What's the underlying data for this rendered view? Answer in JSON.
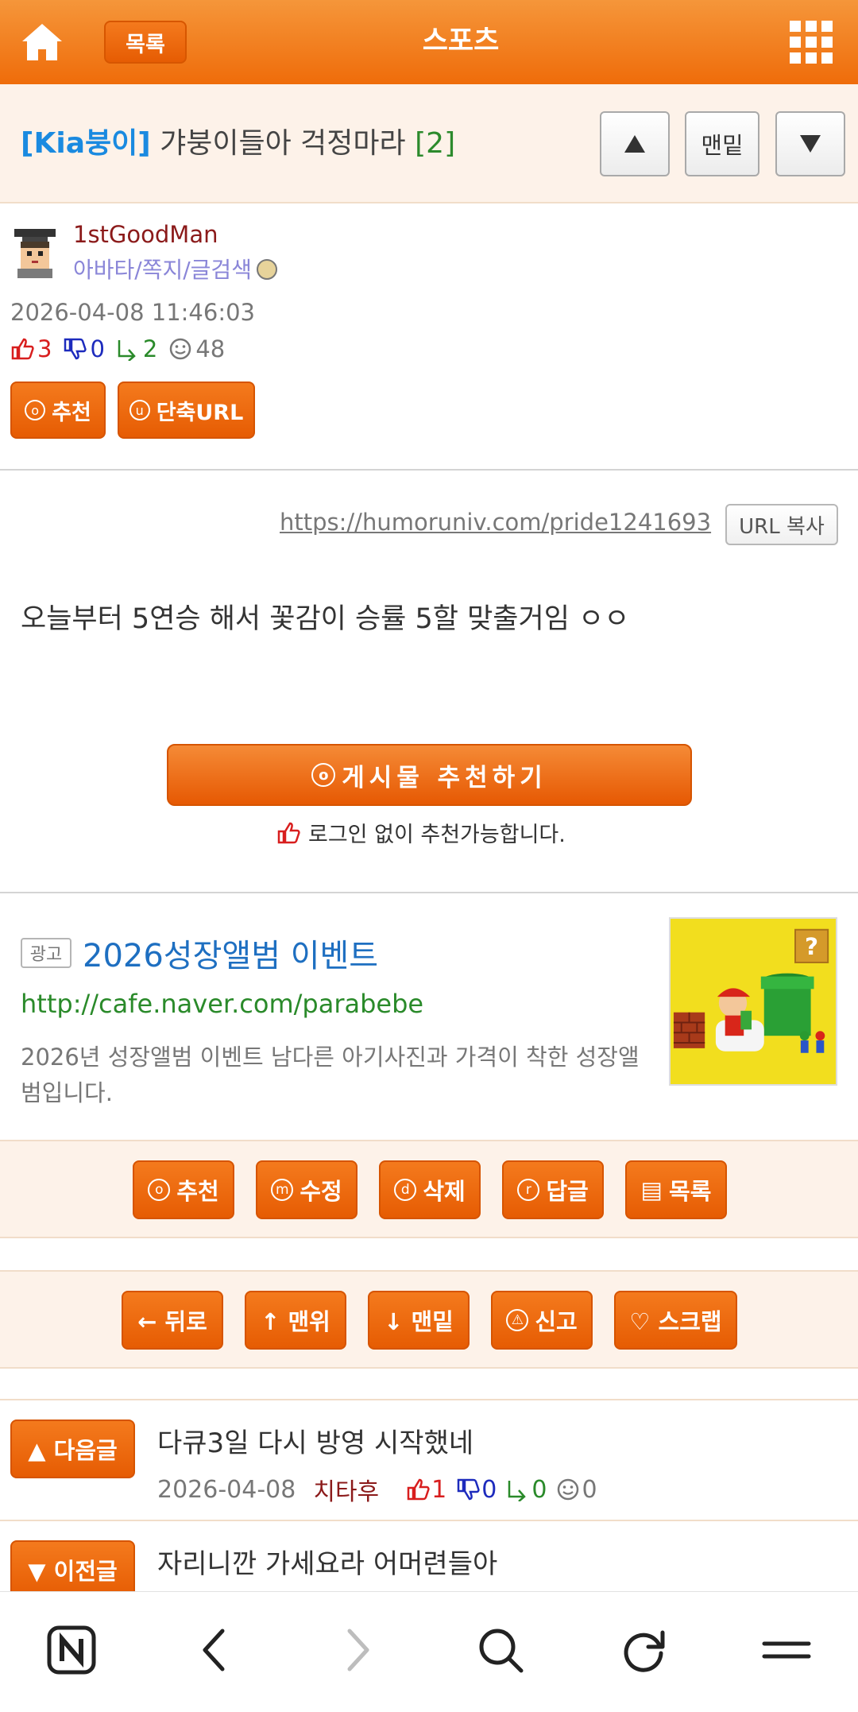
{
  "topbar": {
    "list_label": "목록",
    "section_title": "스포츠",
    "colors": {
      "bar": "#ef6c0a",
      "button": "#e65c03"
    }
  },
  "post": {
    "category": "[Kia붕이]",
    "title": "갸붕이들아 걱정마라",
    "comment_count": "[2]",
    "nav_bottom_label": "맨밑",
    "nav_up_icon": "triangle-up-icon",
    "nav_down_icon": "triangle-down-icon"
  },
  "author": {
    "name": "1stGoodMan",
    "links": "아바타/쪽지/글검색",
    "date": "2026-04-08 11:46:03",
    "likes": "3",
    "dislikes": "0",
    "shares": "2",
    "views": "48"
  },
  "actions": {
    "recommend": {
      "icon": "o",
      "label": "추천"
    },
    "short_url": {
      "icon": "u",
      "label": "단축URL"
    }
  },
  "content": {
    "url": "https://humoruniv.com/pride1241693",
    "url_copy_label": "URL 복사",
    "body": "오늘부터 5연승 해서 꽃감이 승률 5할 맞출거임 ㅇㅇ",
    "recommend_big_icon": "o",
    "recommend_big_label": "게시물 추천하기",
    "no_login_text": "로그인 없이 추천가능합니다."
  },
  "ad": {
    "badge": "광고",
    "title": "2026성장앨범 이벤트",
    "url": "http://cafe.naver.com/parabebe",
    "description": "2026년 성장앨범 이벤트 남다른 아기사진과 가격이 착한 성장앨범입니다."
  },
  "row1": [
    {
      "icon": "o",
      "label": "추천"
    },
    {
      "icon": "m",
      "label": "수정"
    },
    {
      "icon": "d",
      "label": "삭제"
    },
    {
      "icon": "r",
      "label": "답글"
    },
    {
      "icon": "▤",
      "label": "목록"
    }
  ],
  "row2": [
    {
      "label": "← 뒤로"
    },
    {
      "label": "↑ 맨위"
    },
    {
      "label": "↓ 맨밑"
    },
    {
      "icon": "⚠",
      "label": "신고"
    },
    {
      "label": "♡ 스크랩"
    }
  ],
  "next_post": {
    "label": "▲ 다음글",
    "title": "다큐3일 다시 방영 시작했네",
    "date": "2026-04-08",
    "author": "치타후",
    "likes": "1",
    "dislikes": "0",
    "shares": "0",
    "views": "0"
  },
  "prev_post": {
    "label": "▼ 이전글",
    "title": "자리니깐 가세요라 어머련들아"
  },
  "browser_bar": {
    "icons": [
      "naver-icon",
      "back-icon",
      "forward-icon",
      "search-icon",
      "refresh-icon",
      "menu-icon"
    ]
  }
}
